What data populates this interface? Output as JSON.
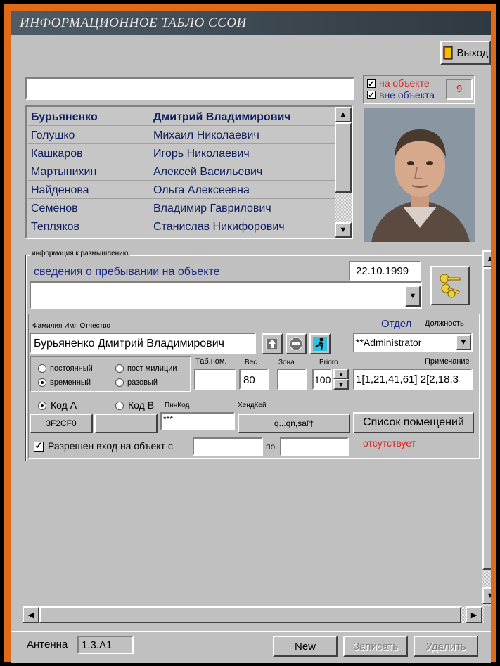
{
  "window": {
    "title": "ИНФОРМАЦИОННОЕ ТАБЛО ССОИ"
  },
  "toolbar": {
    "exit_label": "Выход"
  },
  "search": {
    "value": ""
  },
  "filters": {
    "on_site_label": "на объекте",
    "off_site_label": "вне объекта",
    "count": "9"
  },
  "people": [
    {
      "last": "Бурьяненко",
      "name": "Дмитрий Владимирович"
    },
    {
      "last": "Голушко",
      "name": "Михаил Николаевич"
    },
    {
      "last": "Кашкаров",
      "name": "Игорь Николаевич"
    },
    {
      "last": "Мартынихин",
      "name": "Алексей Васильевич"
    },
    {
      "last": "Найденова",
      "name": "Ольга Алексеевна"
    },
    {
      "last": "Семенов",
      "name": "Владимир Гаврилович"
    },
    {
      "last": "Тепляков",
      "name": "Станислав Никифорович"
    }
  ],
  "info": {
    "group_label": "информация к размышлению",
    "stay_label": "сведения о пребывании на объекте",
    "date": "22.10.1999",
    "stay_value": ""
  },
  "form": {
    "fio_label": "Фамилия Имя Отчество",
    "fio_value": "Бурьяненко Дмитрий Владимирович",
    "dept_label": "Отдел",
    "position_label": "Должность",
    "dept_value": "**Administrator",
    "radio_permanent": "постоянный",
    "radio_police": "пост милиции",
    "radio_temporary": "временный",
    "radio_onetime": "разовый",
    "tab_label": "Таб.ном.",
    "tab_value": "",
    "weight_label": "Вес",
    "weight_value": "80",
    "zone_label": "Зона",
    "zone_value": "",
    "priority_label": "Prioro",
    "priority_value": "100",
    "note_label": "Примечание",
    "note_value": "1[1,21,41,61] 2[2,18,3",
    "code_a_label": "Код А",
    "code_b_label": "Код В",
    "pin_label": "ПинКод",
    "handkey_label": "ХендКей",
    "code_a_value": "3F2CF0",
    "code_b_value": "",
    "pin_value": "***",
    "handkey_value": "q...qn,saľ†",
    "rooms_button": "Список помещений",
    "allowed_label": "Разрешен вход  на объект с",
    "to_label": "по",
    "from_value": "",
    "to_value": "",
    "absent_status": "отсутствует"
  },
  "footer": {
    "antenna_label": "Антенна",
    "antenna_value": "1.3.A1",
    "new_button": "New",
    "save_button": "Записать",
    "delete_button": "Удалить"
  },
  "colors": {
    "status_red": "#e02020",
    "label_blue": "#1a2a8a",
    "window_bg": "#c0c0c0"
  }
}
